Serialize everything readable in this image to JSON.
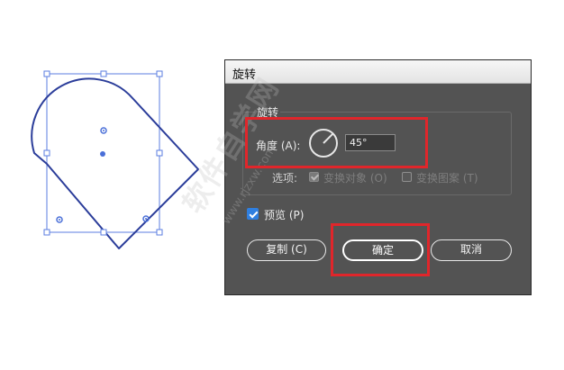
{
  "dialog": {
    "title": "旋转",
    "group_label": "旋转",
    "angle_label": "角度 (A):",
    "angle_value": "45°",
    "options_label": "选项:",
    "option_transform_objects": {
      "label": "变换对象 (O)",
      "checked": true,
      "enabled": false
    },
    "option_transform_patterns": {
      "label": "变换图案 (T)",
      "checked": false,
      "enabled": false
    },
    "preview": {
      "label": "预览 (P)",
      "checked": true
    },
    "buttons": {
      "copy": "复制 (C)",
      "ok": "确定",
      "cancel": "取消"
    }
  },
  "colors": {
    "dialog_bg": "#535353",
    "selection_blue": "#4a6fd8",
    "shape_stroke": "#2b3d9a",
    "highlight_red": "#e0262b",
    "checkbox_blue": "#2f7fe0"
  },
  "watermark": {
    "text": "软件自学网",
    "url": "www.rjzxw.com"
  }
}
